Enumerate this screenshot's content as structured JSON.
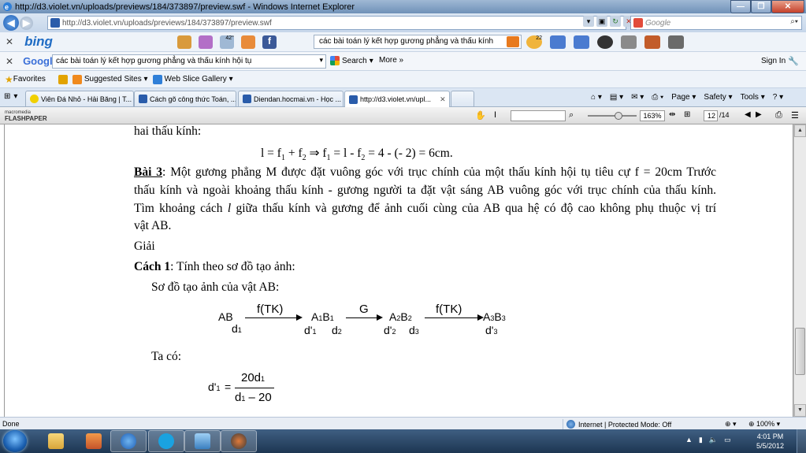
{
  "window": {
    "title": "http://d3.violet.vn/uploads/previews/184/373897/preview.swf - Windows Internet Explorer"
  },
  "address_bar": {
    "url": "http://d3.violet.vn/uploads/previews/184/373897/preview.swf",
    "search_placeholder": "Google"
  },
  "bing_bar": {
    "logo": "bing",
    "weather_temp": "42°",
    "mail_count": "22",
    "query": "các bài toán lý kết hợp gương phẳng và thấu kính"
  },
  "google_bar": {
    "logo": "Google",
    "query": "các bài toán lý kết hợp gương phẳng và thấu kính hội tụ",
    "search_label": "Search",
    "more_label": "More »",
    "signin_label": "Sign In"
  },
  "favorites_bar": {
    "favorites_label": "Favorites",
    "items": [
      "Suggested Sites ▾",
      "Web Slice Gallery ▾"
    ]
  },
  "tabs": [
    {
      "label": "Viên Đá Nhỏ - Hải Băng | T...",
      "color": "#333333"
    },
    {
      "label": "Cách gõ công thức Toán, ...",
      "color": "#2a5caa"
    },
    {
      "label": "Diendan.hocmai.vn - Học ...",
      "color": "#2a5caa"
    },
    {
      "label": "http://d3.violet.vn/upl...",
      "color": "#2a5caa",
      "active": true
    }
  ],
  "command_bar": {
    "page_label": "Page ▾",
    "safety_label": "Safety ▾",
    "tools_label": "Tools ▾"
  },
  "flash_toolbar": {
    "brand_top": "macromedia",
    "brand_bottom": "FLASHPAPER",
    "zoom": "163%",
    "page_current": "12",
    "page_total": "/14"
  },
  "document": {
    "line_intro": "hai thấu kính:",
    "equation": {
      "l": "l = f",
      "s1": "1",
      "plus": " + f",
      "s2": "2",
      "implies": " ⇒ f",
      "s3": "1",
      "rest1": " = l - f",
      "s4": "2",
      "rest2": " = 4 - (- 2) = 6cm."
    },
    "bai3_label": "Bài 3",
    "bai3_line1": ": Một gương phẳng M được đặt vuông góc với trục chính của một thấu kính hội tụ tiêu cự f = 20cm Trước",
    "bai3_line2": "thấu kính và ngoài khoảng thấu kính - gương người ta đặt vật sáng AB vuông góc với trục chính của thấu kính.",
    "bai3_line3_a": "Tìm khoảng cách ",
    "bai3_line3_var": "l",
    "bai3_line3_b": " giữa thấu kính và gương để ảnh cuối cùng của AB qua hệ có độ cao không phụ thuộc vị trí",
    "bai3_line4": "vật AB.",
    "giai": "Giải",
    "cach1_label": "Cách 1",
    "cach1_text": ":    Tính theo sơ đồ tạo ảnh:",
    "so_do": "Sơ đồ tạo ảnh của vật AB:",
    "scheme": {
      "ab": "AB",
      "d1": "d",
      "d1s": "1",
      "f_tk_1": "f(TK)",
      "a1b1": "A",
      "a1b1_s1": "1",
      "a1b1_b": "B",
      "a1b1_s2": "1",
      "d1p": "d'",
      "d1p_s": "1",
      "d2": "d",
      "d2_s": "2",
      "g": "G",
      "a2b2": "A",
      "a2b2_s1": "2",
      "a2b2_b": "B",
      "a2b2_s2": "2",
      "d2p": "d'",
      "d2p_s": "2",
      "d3": "d",
      "d3_s": "3",
      "f_tk_2": "f(TK)",
      "a3b3": "A",
      "a3b3_s1": "3",
      "a3b3_b": "B",
      "a3b3_s2": "3",
      "d3p": "d'",
      "d3p_s": "3"
    },
    "ta_co": "Ta có:",
    "formula": {
      "lhs": "d'",
      "lhs_s": "1",
      "eq": "=",
      "num": "20d",
      "num_s": "1",
      "den": "d",
      "den_s": "1",
      "den_rest": " – 20"
    }
  },
  "status_bar": {
    "left": "Done",
    "zone": "Internet | Protected Mode: Off",
    "zoom": "100%"
  },
  "taskbar": {
    "time": "4:01 PM",
    "date": "5/5/2012"
  }
}
